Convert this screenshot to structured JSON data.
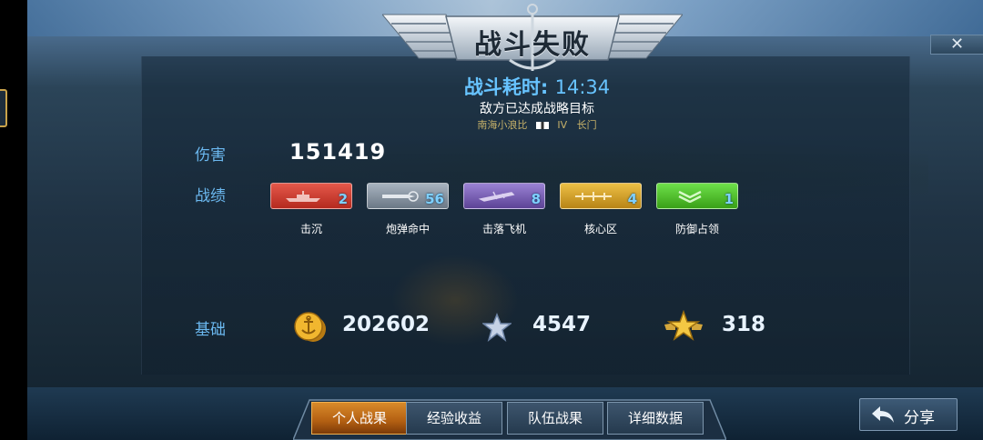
{
  "banner": {
    "title": "战斗失败"
  },
  "header": {
    "time_label": "战斗耗时:",
    "time_value": "14:34",
    "subtitle": "敌方已达成战略目标",
    "player_name": "南海小浪比",
    "ship_tier": "IV",
    "ship_name": "长门"
  },
  "damage": {
    "label": "伤害",
    "value": "151419"
  },
  "achievements": {
    "label": "战绩",
    "items": [
      {
        "name": "击沉",
        "count": "2",
        "color": "#d93a2e"
      },
      {
        "name": "炮弹命中",
        "count": "56",
        "color": "#8e9aa8"
      },
      {
        "name": "击落飞机",
        "count": "8",
        "color": "#7a5fb8"
      },
      {
        "name": "核心区",
        "count": "4",
        "color": "#d6a12a"
      },
      {
        "name": "防御占领",
        "count": "1",
        "color": "#4fbf2a"
      }
    ]
  },
  "base": {
    "label": "基础",
    "coins": "202602",
    "silver_star": "4547",
    "gold_star": "318"
  },
  "tabs": [
    {
      "label": "个人战果",
      "active": true
    },
    {
      "label": "经验收益",
      "active": false
    },
    {
      "label": "队伍战果",
      "active": false
    },
    {
      "label": "详细数据",
      "active": false
    }
  ],
  "share": {
    "label": "分享"
  },
  "close": {
    "label": "✕"
  },
  "colors": {
    "accent_blue": "#67c3ff",
    "label_blue": "#6bb8ef",
    "active_tab": "#c9741c"
  }
}
